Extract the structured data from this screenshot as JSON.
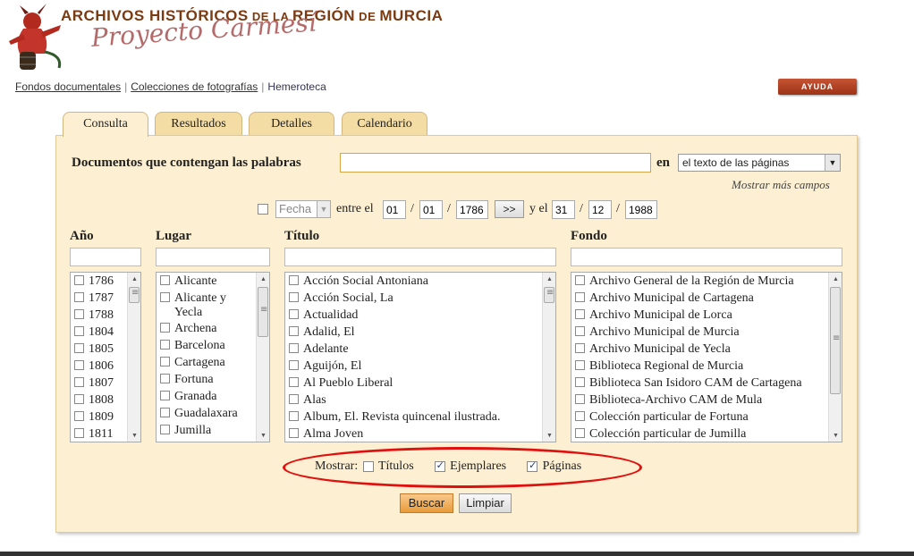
{
  "header": {
    "title_parts": [
      "ARCHIVOS HISTÓRICOS",
      " DE LA ",
      "REGIÓN",
      " DE ",
      "MURCIA"
    ],
    "subtitle": "Proyecto Carmesí"
  },
  "topnav": {
    "link1": "Fondos documentales",
    "link2": "Colecciones de fotografías",
    "link3": "Hemeroteca",
    "separator": "|"
  },
  "help_button": "AYUDA",
  "tabs": [
    "Consulta",
    "Resultados",
    "Detalles",
    "Calendario"
  ],
  "search": {
    "label": "Documentos que contengan las palabras",
    "value": "",
    "in_label": "en",
    "field_selected": "el texto de las páginas",
    "more_fields": "Mostrar más campos"
  },
  "date": {
    "type_selected": "Fecha",
    "between": "entre el",
    "from_day": "01",
    "from_month": "01",
    "from_year": "1786",
    "go": ">>",
    "and": "y el",
    "to_day": "31",
    "to_month": "12",
    "to_year": "1988",
    "slash": "/"
  },
  "columns": {
    "year": {
      "label": "Año",
      "items": [
        "1786",
        "1787",
        "1788",
        "1804",
        "1805",
        "1806",
        "1807",
        "1808",
        "1809",
        "1811"
      ]
    },
    "place": {
      "label": "Lugar",
      "items": [
        "Alicante",
        "Alicante y Yecla",
        "Archena",
        "Barcelona",
        "Cartagena",
        "Fortuna",
        "Granada",
        "Guadalaxara",
        "Jumilla"
      ]
    },
    "title": {
      "label": "Título",
      "items": [
        "Acción Social Antoniana",
        "Acción Social, La",
        "Actualidad",
        "Adalid, El",
        "Adelante",
        "Aguijón, El",
        "Al Pueblo Liberal",
        "Alas",
        "Album, El. Revista quincenal ilustrada.",
        "Alma Joven"
      ]
    },
    "fund": {
      "label": "Fondo",
      "items": [
        "Archivo General de la Región de Murcia",
        "Archivo Municipal de Cartagena",
        "Archivo Municipal de Lorca",
        "Archivo Municipal de Murcia",
        "Archivo Municipal de Yecla",
        "Biblioteca Regional de Murcia",
        "Biblioteca San Isidoro CAM de Cartagena",
        "Biblioteca-Archivo CAM de Mula",
        "Colección particular de Fortuna",
        "Colección particular de Jumilla"
      ]
    }
  },
  "show": {
    "label": "Mostrar:",
    "titles": "Títulos",
    "copies": "Ejemplares",
    "pages": "Páginas"
  },
  "buttons": {
    "search": "Buscar",
    "clear": "Limpiar"
  }
}
